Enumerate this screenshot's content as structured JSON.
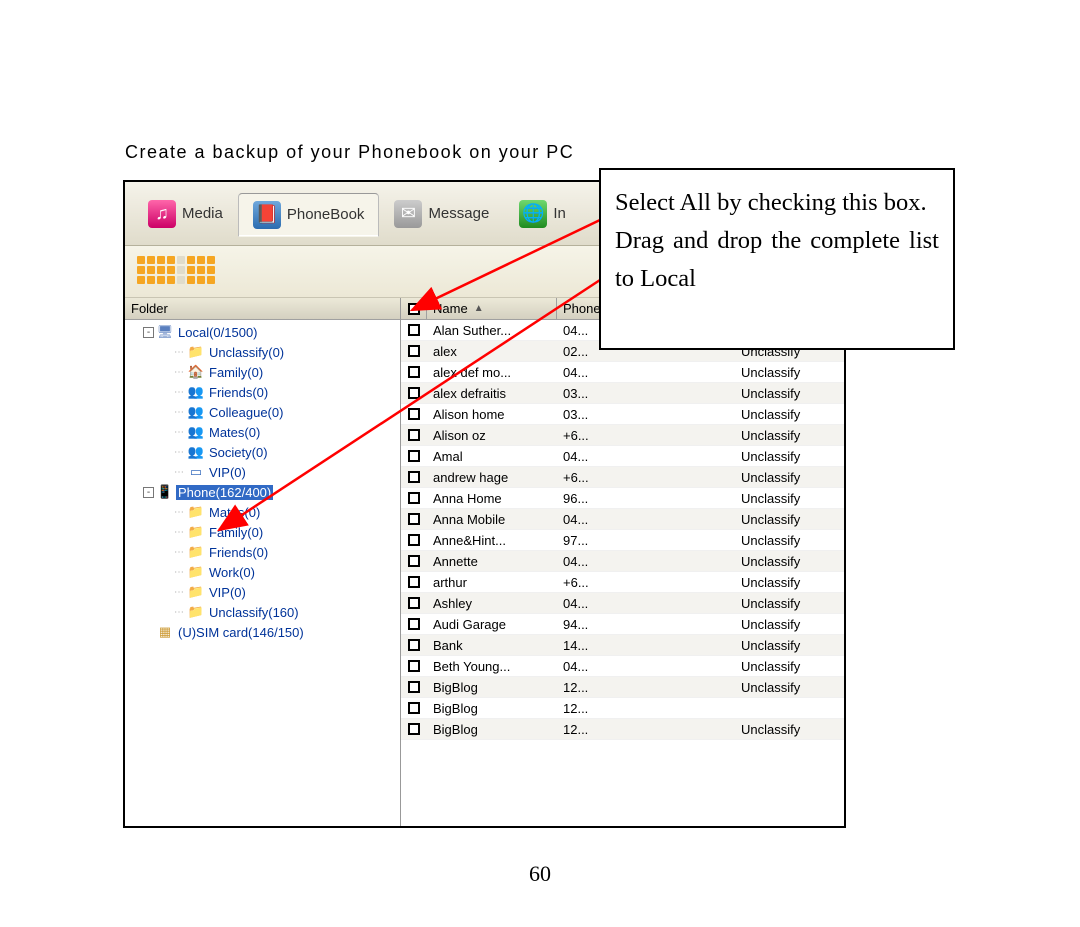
{
  "caption": "Create a backup of your Phonebook on your PC",
  "tabs": {
    "media": "Media",
    "phonebook": "PhoneBook",
    "message": "Message",
    "internet": "In"
  },
  "tree": {
    "header": "Folder",
    "nodes": [
      {
        "kind": "root-pc",
        "twisty": "-",
        "label": "Local(0/1500)"
      },
      {
        "kind": "folder",
        "indent": 2,
        "icon": "folder",
        "label": "Unclassify(0)"
      },
      {
        "kind": "folder",
        "indent": 2,
        "icon": "family",
        "label": "Family(0)"
      },
      {
        "kind": "folder",
        "indent": 2,
        "icon": "people",
        "label": "Friends(0)"
      },
      {
        "kind": "folder",
        "indent": 2,
        "icon": "people",
        "label": "Colleague(0)"
      },
      {
        "kind": "folder",
        "indent": 2,
        "icon": "people",
        "label": "Mates(0)"
      },
      {
        "kind": "folder",
        "indent": 2,
        "icon": "people",
        "label": "Society(0)"
      },
      {
        "kind": "folder",
        "indent": 2,
        "icon": "card",
        "label": "VIP(0)"
      },
      {
        "kind": "root-phone",
        "twisty": "-",
        "label": "Phone(162/400)",
        "selected": true
      },
      {
        "kind": "folder",
        "indent": 2,
        "icon": "folder",
        "label": "Mates(0)"
      },
      {
        "kind": "folder",
        "indent": 2,
        "icon": "folder",
        "label": "Family(0)"
      },
      {
        "kind": "folder",
        "indent": 2,
        "icon": "folder",
        "label": "Friends(0)"
      },
      {
        "kind": "folder",
        "indent": 2,
        "icon": "folder",
        "label": "Work(0)"
      },
      {
        "kind": "folder",
        "indent": 2,
        "icon": "folder",
        "label": "VIP(0)"
      },
      {
        "kind": "folder",
        "indent": 2,
        "icon": "folder",
        "label": "Unclassify(160)"
      },
      {
        "kind": "root-sim",
        "twisty": " ",
        "label": "(U)SIM card(146/150)"
      }
    ]
  },
  "table": {
    "columns": {
      "name": "Name",
      "phone": "Phone"
    },
    "rows": [
      {
        "name": "Alan Suther...",
        "phone": "04...",
        "group": ""
      },
      {
        "name": "alex",
        "phone": "02...",
        "group": "Unclassify"
      },
      {
        "name": "alex def  mo...",
        "phone": "04...",
        "group": "Unclassify"
      },
      {
        "name": "alex defraitis",
        "phone": "03...",
        "group": "Unclassify"
      },
      {
        "name": "Alison home",
        "phone": "03...",
        "group": "Unclassify"
      },
      {
        "name": "Alison oz",
        "phone": "+6...",
        "group": "Unclassify"
      },
      {
        "name": "Amal",
        "phone": "04...",
        "group": "Unclassify"
      },
      {
        "name": "andrew hage",
        "phone": "+6...",
        "group": "Unclassify"
      },
      {
        "name": "Anna Home",
        "phone": "96...",
        "group": "Unclassify"
      },
      {
        "name": "Anna Mobile",
        "phone": "04...",
        "group": "Unclassify"
      },
      {
        "name": "Anne&Hint...",
        "phone": "97...",
        "group": "Unclassify"
      },
      {
        "name": "Annette",
        "phone": "04...",
        "group": "Unclassify"
      },
      {
        "name": "arthur",
        "phone": "+6...",
        "group": "Unclassify"
      },
      {
        "name": "Ashley",
        "phone": "04...",
        "group": "Unclassify"
      },
      {
        "name": "Audi Garage",
        "phone": "94...",
        "group": "Unclassify"
      },
      {
        "name": "Bank",
        "phone": "14...",
        "group": "Unclassify"
      },
      {
        "name": "Beth Young...",
        "phone": "04...",
        "group": "Unclassify"
      },
      {
        "name": "BigBlog",
        "phone": "12...",
        "group": "Unclassify"
      },
      {
        "name": "BigBlog",
        "phone": "12...",
        "group": ""
      },
      {
        "name": "BigBlog",
        "phone": "12...",
        "group": "Unclassify"
      }
    ]
  },
  "callout": {
    "line1": "Select All by checking this box.",
    "line2": "Drag and drop the complete list to Local"
  },
  "page_number": "60",
  "colors": {
    "arrow": "#ff0000",
    "selection": "#316ac5"
  }
}
